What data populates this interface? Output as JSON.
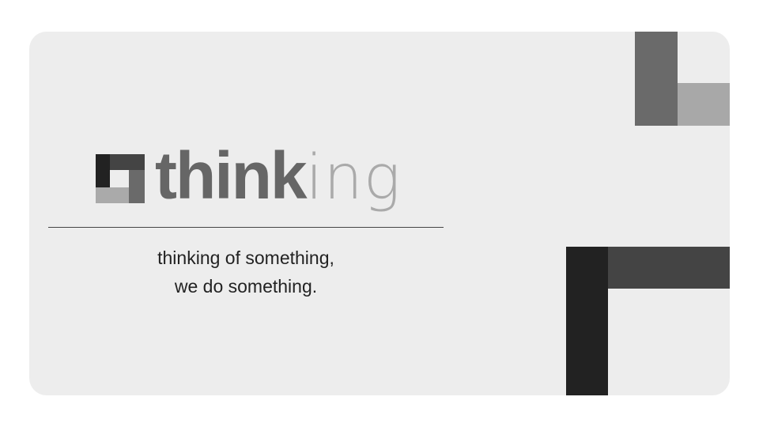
{
  "logo": {
    "bold_part": "think",
    "light_part": "ing"
  },
  "tagline": {
    "line1": "thinking of something,",
    "line2": "we do something."
  },
  "colors": {
    "background": "#ededed",
    "dark": "#222222",
    "mid_dark": "#444444",
    "mid": "#6a6a6a",
    "light": "#a8a8a8"
  }
}
